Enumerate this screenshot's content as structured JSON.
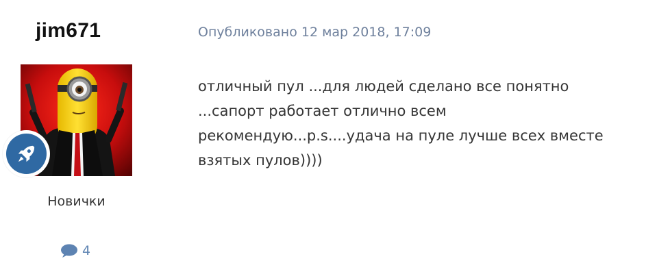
{
  "author": {
    "username": "jim671",
    "rank_title": "Новички",
    "post_count": "4",
    "avatar_icon": "minion-avatar",
    "rank_icon": "rocket-icon",
    "post_count_icon": "comment-icon"
  },
  "post": {
    "date": "Опубликовано 12 мар 2018, 17:09",
    "lines": [
      "отличный пул ...для людей сделано все понятно",
      "...сапорт работает отлично всем",
      "рекомендую...p.s....удача на пуле лучше всех вместе",
      "взятых пулов))))"
    ]
  },
  "colors": {
    "rank_badge": "#2f69a3",
    "date_text": "#6f819d",
    "post_count": "#5d83b2",
    "body_text": "#353535"
  }
}
